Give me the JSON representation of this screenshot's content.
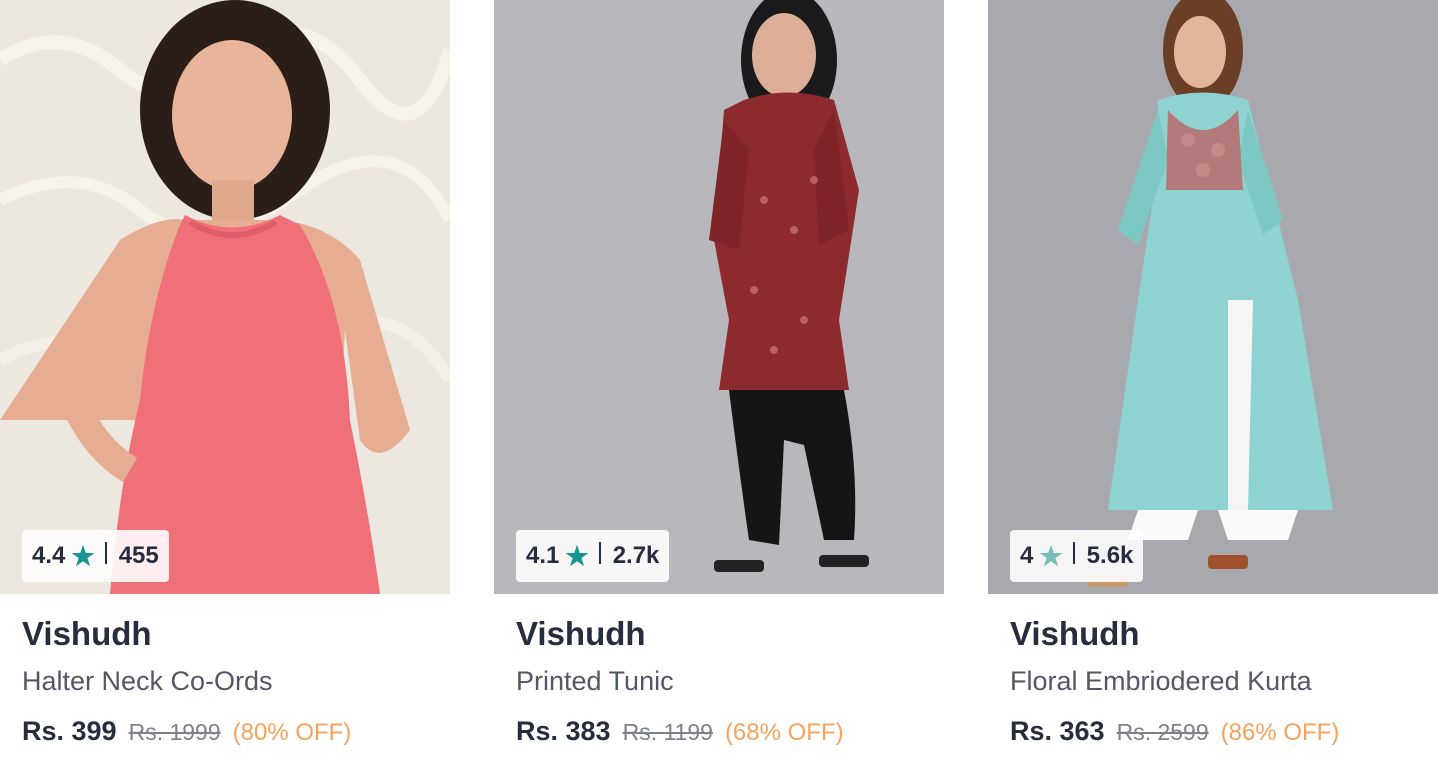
{
  "products": [
    {
      "rating": "4.4",
      "rating_count": "455",
      "star_color": "#14958f",
      "brand": "Vishudh",
      "title": "Halter Neck Co-Ords",
      "price": "Rs. 399",
      "mrp": "Rs. 1999",
      "discount": "(80% OFF)"
    },
    {
      "rating": "4.1",
      "rating_count": "2.7k",
      "star_color": "#14958f",
      "brand": "Vishudh",
      "title": "Printed Tunic",
      "price": "Rs. 383",
      "mrp": "Rs. 1199",
      "discount": "(68% OFF)"
    },
    {
      "rating": "4",
      "rating_count": "5.6k",
      "star_color": "#72bfbc",
      "brand": "Vishudh",
      "title": "Floral Embriodered Kurta",
      "price": "Rs. 363",
      "mrp": "Rs. 2599",
      "discount": "(86% OFF)"
    }
  ],
  "icons": {
    "star": "star-icon"
  },
  "colors": {
    "discount": "#f5a25d",
    "brand_text": "#282c3f"
  }
}
